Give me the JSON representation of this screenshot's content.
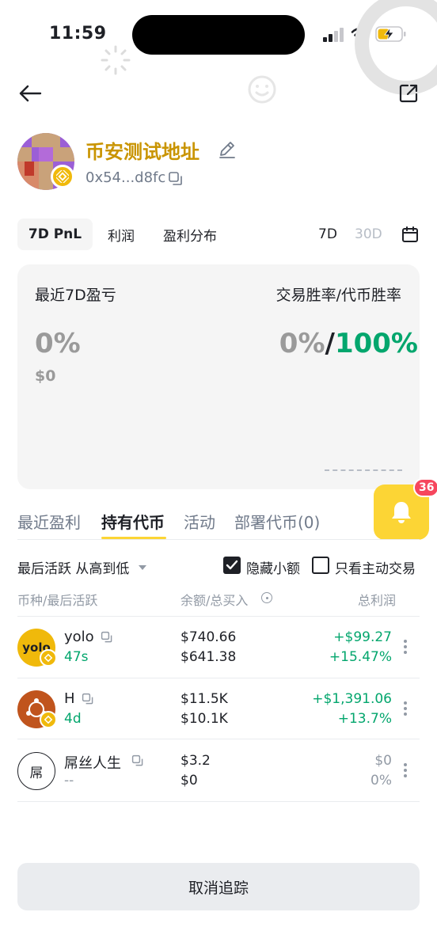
{
  "status_bar": {
    "time": "11:59"
  },
  "profile": {
    "name": "币安测试地址",
    "address": "0x54...d8fc"
  },
  "tabs": {
    "items": [
      "7D PnL",
      "利润",
      "盈利分布"
    ],
    "active": "7D PnL",
    "ranges": [
      "7D",
      "30D"
    ],
    "active_range": "7D"
  },
  "card": {
    "left_label": "最近7D盈亏",
    "right_label": "交易胜率/代币胜率",
    "pnl_pct": "0%",
    "pnl_usd": "$0",
    "trade_win_rate": "0%",
    "separator": "/",
    "token_win_rate": "100%"
  },
  "notifications": {
    "count": "36"
  },
  "section_tabs": {
    "items": [
      "最近盈利",
      "持有代币",
      "活动",
      "部署代币(0)"
    ],
    "active": "持有代币"
  },
  "filters": {
    "sort_label": "最后活跃 从高到低",
    "hide_small_label": "隐藏小额",
    "hide_small_checked": true,
    "active_only_label": "只看主动交易",
    "active_only_checked": false
  },
  "table": {
    "headers": {
      "token": "币种/最后活跃",
      "balance": "余额/总买入",
      "pnl": "总利润"
    },
    "rows": [
      {
        "name": "yolo",
        "icon_text": "yolo",
        "active": "47s",
        "balance": "$740.66",
        "bought": "$641.38",
        "pnl": "+$99.27",
        "pnl_pct": "+15.47%"
      },
      {
        "name": "H",
        "icon_text": "",
        "active": "4d",
        "balance": "$11.5K",
        "bought": "$10.1K",
        "pnl": "+$1,391.06",
        "pnl_pct": "+13.7%"
      },
      {
        "name": "屌丝人生",
        "icon_text": "屌",
        "active": "--",
        "balance": "$3.2",
        "bought": "$0",
        "pnl": "$0",
        "pnl_pct": "0%"
      }
    ]
  },
  "actions": {
    "untrack_label": "取消追踪"
  },
  "colors": {
    "brand": "#fcd535",
    "name_gold": "#c99400",
    "up": "#03a66d",
    "badge": "#f6465d"
  }
}
